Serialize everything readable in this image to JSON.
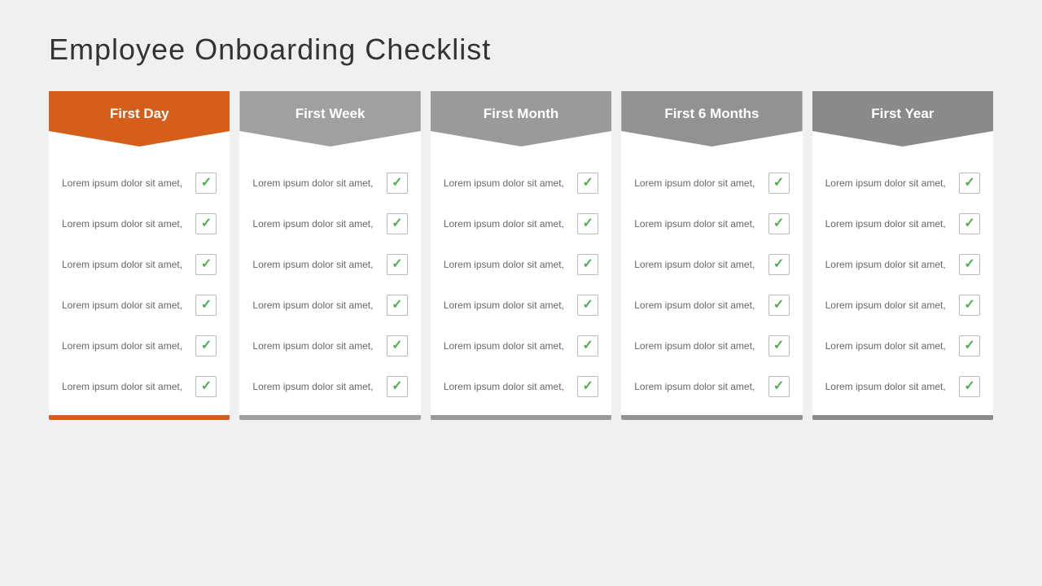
{
  "page": {
    "title": "Employee  Onboarding Checklist"
  },
  "columns": [
    {
      "id": "first-day",
      "header": "First Day",
      "colorClass": "orange",
      "items": [
        {
          "text": "Lorem ipsum dolor sit amet,"
        },
        {
          "text": "Lorem ipsum dolor sit amet,"
        },
        {
          "text": "Lorem ipsum dolor sit amet,"
        },
        {
          "text": "Lorem ipsum dolor sit amet,"
        },
        {
          "text": "Lorem ipsum dolor sit amet,"
        },
        {
          "text": "Lorem ipsum dolor sit amet,"
        }
      ]
    },
    {
      "id": "first-week",
      "header": "First Week",
      "colorClass": "gray1",
      "items": [
        {
          "text": "Lorem ipsum dolor sit amet,"
        },
        {
          "text": "Lorem ipsum dolor sit amet,"
        },
        {
          "text": "Lorem ipsum dolor sit amet,"
        },
        {
          "text": "Lorem ipsum dolor sit amet,"
        },
        {
          "text": "Lorem ipsum dolor sit amet,"
        },
        {
          "text": "Lorem ipsum dolor sit amet,"
        }
      ]
    },
    {
      "id": "first-month",
      "header": "First Month",
      "colorClass": "gray2",
      "items": [
        {
          "text": "Lorem ipsum dolor sit amet,"
        },
        {
          "text": "Lorem ipsum dolor sit amet,"
        },
        {
          "text": "Lorem ipsum dolor sit amet,"
        },
        {
          "text": "Lorem ipsum dolor sit amet,"
        },
        {
          "text": "Lorem ipsum dolor sit amet,"
        },
        {
          "text": "Lorem ipsum dolor sit amet,"
        }
      ]
    },
    {
      "id": "first-6-months",
      "header": "First 6 Months",
      "colorClass": "gray3",
      "items": [
        {
          "text": "Lorem ipsum dolor sit amet,"
        },
        {
          "text": "Lorem ipsum dolor sit amet,"
        },
        {
          "text": "Lorem ipsum dolor sit amet,"
        },
        {
          "text": "Lorem ipsum dolor sit amet,"
        },
        {
          "text": "Lorem ipsum dolor sit amet,"
        },
        {
          "text": "Lorem ipsum dolor sit amet,"
        }
      ]
    },
    {
      "id": "first-year",
      "header": "First Year",
      "colorClass": "gray4",
      "items": [
        {
          "text": "Lorem ipsum dolor sit amet,"
        },
        {
          "text": "Lorem ipsum dolor sit amet,"
        },
        {
          "text": "Lorem ipsum dolor sit amet,"
        },
        {
          "text": "Lorem ipsum dolor sit amet,"
        },
        {
          "text": "Lorem ipsum dolor sit amet,"
        },
        {
          "text": "Lorem ipsum dolor sit amet,"
        }
      ]
    }
  ],
  "checkmark": "✓"
}
